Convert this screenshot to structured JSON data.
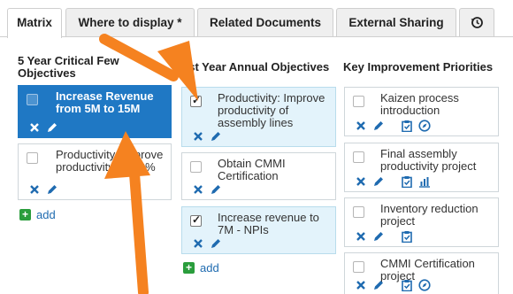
{
  "tabs": [
    {
      "label": "Matrix",
      "active": true
    },
    {
      "label": "Where to display *",
      "active": false
    },
    {
      "label": "Related Documents",
      "active": false
    },
    {
      "label": "External Sharing",
      "active": false
    }
  ],
  "columns": {
    "five_year": {
      "header": "5 Year Critical Few Objectives",
      "cards": [
        {
          "text": "Increase Revenue from 5M to 15M",
          "checked": false,
          "selected": true
        },
        {
          "text": "Productivity: Improve productivity by 60%",
          "checked": false,
          "selected": false
        }
      ],
      "add_label": "add"
    },
    "first_year": {
      "header": "1st Year Annual Objectives",
      "cards": [
        {
          "text": "Productivity: Improve productivity of assembly lines",
          "checked": true
        },
        {
          "text": "Obtain CMMI Certification",
          "checked": false
        },
        {
          "text": "Increase revenue to 7M - NPIs",
          "checked": true
        }
      ],
      "add_label": "add"
    },
    "priorities": {
      "header": "Key Improvement Priorities",
      "cards": [
        {
          "text": "Kaizen process introduction",
          "checked": false,
          "icons": [
            "clipboard-icon",
            "compass-icon"
          ]
        },
        {
          "text": "Final assembly productivity project",
          "checked": false,
          "icons": [
            "clipboard-icon",
            "bar-chart-icon"
          ]
        },
        {
          "text": "Inventory reduction project",
          "checked": false,
          "icons": [
            "clipboard-icon"
          ]
        },
        {
          "text": "CMMI Certification project",
          "checked": false,
          "icons": [
            "clipboard-icon",
            "compass-icon"
          ]
        }
      ]
    }
  },
  "colors": {
    "selected_card": "#1f78c4",
    "linked_card": "#e3f3fb",
    "action_icon": "#1f6bb0",
    "add_icon": "#2a9d3c",
    "annotation_arrow": "#f58220"
  }
}
